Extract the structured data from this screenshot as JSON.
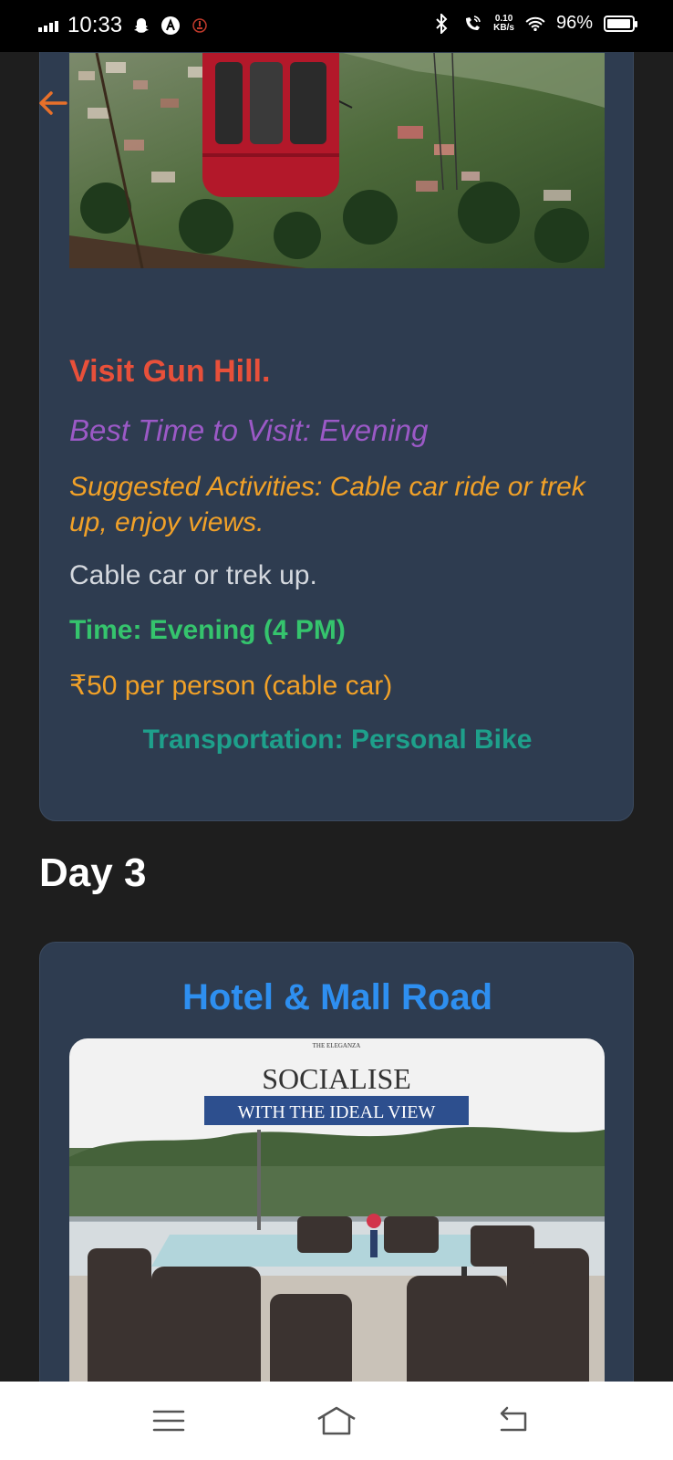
{
  "status_bar": {
    "time": "10:33",
    "speed_value": "0.10",
    "speed_unit": "KB/s",
    "battery": "96%",
    "battery_level": 0.96,
    "icons": [
      "signal-icon",
      "snapchat-icon",
      "app-a-icon",
      "notification-icon",
      "bluetooth-icon",
      "wifi-calling-icon",
      "wifi-icon",
      "battery-icon"
    ]
  },
  "header": {
    "back_icon": "arrow-left-icon",
    "accent_color": "#e8702a"
  },
  "day2_card": {
    "title": "Visit Gun Hill.",
    "best_time": "Best Time to Visit: Evening",
    "activities": "Suggested Activities: Cable car ride or trek up, enjoy views.",
    "description": "Cable car or trek up.",
    "time": "Time: Evening (4 PM)",
    "price": "₹50 per person (cable car)",
    "transport": "Transportation: Personal Bike",
    "image": "Red cable car over a hill town"
  },
  "day3": {
    "heading": "Day 3",
    "card": {
      "title": "Hotel & Mall Road",
      "image_brand": "THE ELEGANZA",
      "image_headline": "SOCIALISE",
      "image_subline": "WITH THE IDEAL VIEW"
    }
  },
  "nav_bar": {
    "buttons": [
      "menu-icon",
      "home-icon",
      "back-icon"
    ]
  },
  "colors": {
    "background": "#1e1e1e",
    "card": "#2e3c50",
    "title": "#e8503a",
    "best_time": "#9b59c6",
    "activities": "#f1a128",
    "time": "#35c46d",
    "transport": "#1ea08b",
    "day3_title": "#2e8ff0"
  }
}
